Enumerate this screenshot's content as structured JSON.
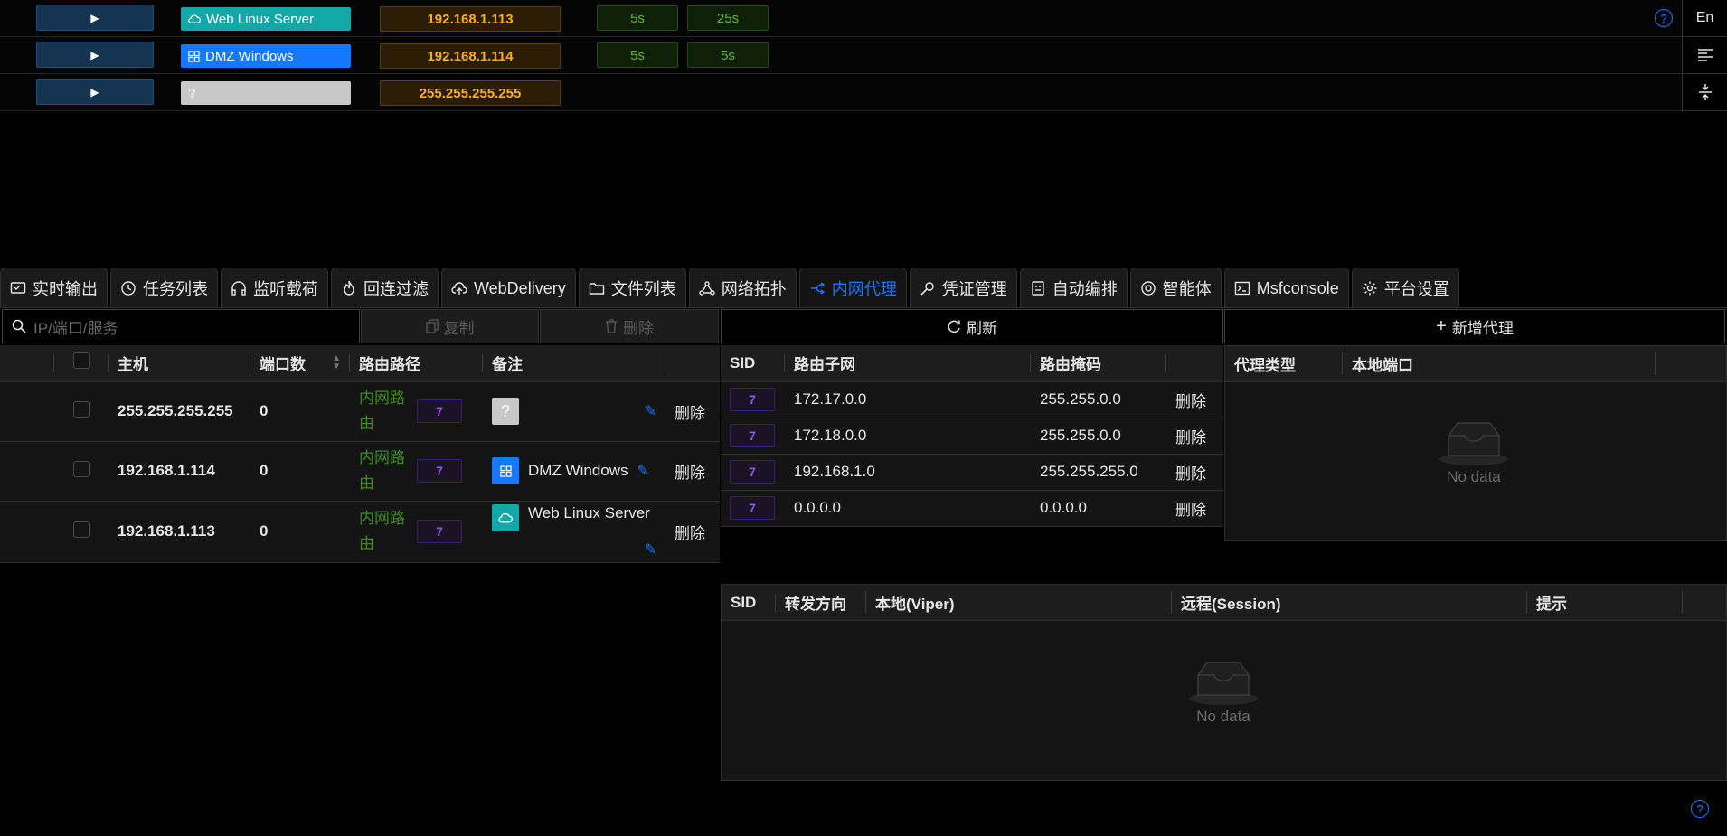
{
  "hosts": [
    {
      "name": "Web Linux Server",
      "ip": "192.168.1.113",
      "t1": "5s",
      "t2": "25s",
      "color": "#13a8a8",
      "icon": "cloud-icon"
    },
    {
      "name": "DMZ Windows",
      "ip": "192.168.1.114",
      "t1": "5s",
      "t2": "5s",
      "color": "#1677ff",
      "icon": "windows-icon"
    },
    {
      "name": "?",
      "ip": "255.255.255.255",
      "color": "#bfbfbf",
      "icon": "question-icon"
    }
  ],
  "rightbar": {
    "lang": "En"
  },
  "tabs": [
    {
      "label": "实时输出",
      "icon": "monitor-icon"
    },
    {
      "label": "任务列表",
      "icon": "clock-icon"
    },
    {
      "label": "监听载荷",
      "icon": "headphones-icon"
    },
    {
      "label": "回连过滤",
      "icon": "fire-icon"
    },
    {
      "label": "WebDelivery",
      "icon": "cloud-upload-icon"
    },
    {
      "label": "文件列表",
      "icon": "folder-icon"
    },
    {
      "label": "网络拓扑",
      "icon": "topology-icon"
    },
    {
      "label": "内网代理",
      "icon": "proxy-icon"
    },
    {
      "label": "凭证管理",
      "icon": "key-icon"
    },
    {
      "label": "自动编排",
      "icon": "robot-icon"
    },
    {
      "label": "智能体",
      "icon": "ai-icon"
    },
    {
      "label": "Msfconsole",
      "icon": "terminal-icon"
    },
    {
      "label": "平台设置",
      "icon": "settings-icon"
    }
  ],
  "toolbar": {
    "search_placeholder": "IP/端口/服务",
    "copy": "复制",
    "delete": "删除",
    "refresh": "刷新",
    "add_proxy": "新增代理"
  },
  "host_table": {
    "headers": {
      "host": "主机",
      "ports": "端口数",
      "route": "路由路径",
      "note": "备注"
    },
    "rows": [
      {
        "ip": "255.255.255.255",
        "ports": "0",
        "route": "内网路由",
        "sid": "7",
        "note": "",
        "tag": "?",
        "del": "删除"
      },
      {
        "ip": "192.168.1.114",
        "ports": "0",
        "route": "内网路由",
        "sid": "7",
        "note": "DMZ Windows",
        "del": "删除"
      },
      {
        "ip": "192.168.1.113",
        "ports": "0",
        "route": "内网路由",
        "sid": "7",
        "note": "Web Linux Server",
        "del": "删除"
      }
    ]
  },
  "route_table": {
    "headers": {
      "sid": "SID",
      "subnet": "路由子网",
      "mask": "路由掩码"
    },
    "rows": [
      {
        "sid": "7",
        "subnet": "172.17.0.0",
        "mask": "255.255.0.0",
        "del": "删除"
      },
      {
        "sid": "7",
        "subnet": "172.18.0.0",
        "mask": "255.255.0.0",
        "del": "删除"
      },
      {
        "sid": "7",
        "subnet": "192.168.1.0",
        "mask": "255.255.255.0",
        "del": "删除"
      },
      {
        "sid": "7",
        "subnet": "0.0.0.0",
        "mask": "0.0.0.0",
        "del": "删除"
      }
    ]
  },
  "proxy_table": {
    "headers": {
      "type": "代理类型",
      "port": "本地端口"
    },
    "empty": "No data"
  },
  "forward_table": {
    "headers": {
      "sid": "SID",
      "dir": "转发方向",
      "local": "本地(Viper)",
      "remote": "远程(Session)",
      "hint": "提示"
    },
    "empty": "No data"
  }
}
